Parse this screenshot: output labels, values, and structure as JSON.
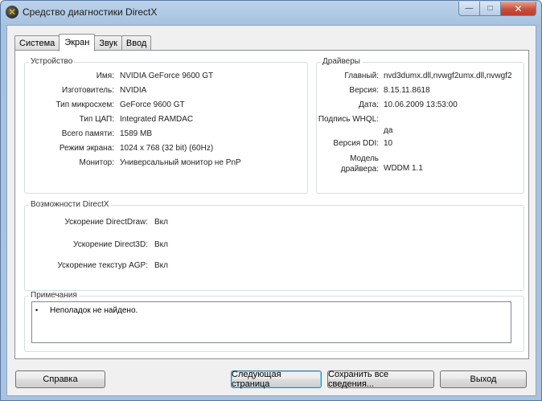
{
  "window": {
    "title": "Средство диагностики DirectX",
    "controls": {
      "minimize": "—",
      "maximize": "□",
      "close": "✕"
    }
  },
  "tabs": [
    {
      "label": "Система",
      "active": false
    },
    {
      "label": "Экран",
      "active": true
    },
    {
      "label": "Звук",
      "active": false
    },
    {
      "label": "Ввод",
      "active": false
    }
  ],
  "device": {
    "title": "Устройство",
    "rows": [
      {
        "label": "Имя:",
        "value": "NVIDIA GeForce 9600 GT"
      },
      {
        "label": "Изготовитель:",
        "value": "NVIDIA"
      },
      {
        "label": "Тип микросхем:",
        "value": "GeForce 9600 GT"
      },
      {
        "label": "Тип ЦАП:",
        "value": "Integrated RAMDAC"
      },
      {
        "label": "Всего памяти:",
        "value": "1589 MB"
      },
      {
        "label": "Режим экрана:",
        "value": "1024 x 768 (32 bit) (60Hz)"
      },
      {
        "label": "Монитор:",
        "value": "Универсальный монитор не PnP"
      }
    ]
  },
  "drivers": {
    "title": "Драйверы",
    "rows": [
      {
        "label": "Главный:",
        "value": "nvd3dumx.dll,nvwgf2umx.dll,nvwgf2"
      },
      {
        "label": "Версия:",
        "value": "8.15.11.8618"
      },
      {
        "label": "Дата:",
        "value": "10.06.2009 13:53:00"
      },
      {
        "label": "Подпись WHQL:",
        "value": "да"
      },
      {
        "label": "Версия DDI:",
        "value": "10"
      },
      {
        "label": "Модель\nдрайвера:",
        "value": "WDDM 1.1"
      }
    ]
  },
  "features": {
    "title": "Возможности DirectX",
    "rows": [
      {
        "label": "Ускорение DirectDraw:",
        "value": "Вкл"
      },
      {
        "label": "Ускорение Direct3D:",
        "value": "Вкл"
      },
      {
        "label": "Ускорение текстур AGP:",
        "value": "Вкл"
      }
    ]
  },
  "notes": {
    "title": "Примечания",
    "bullet": "•",
    "items": [
      "Неполадок не найдено."
    ]
  },
  "buttons": {
    "help": "Справка",
    "next_page": "Следующая страница",
    "save_all": "Сохранить все сведения...",
    "exit": "Выход"
  }
}
